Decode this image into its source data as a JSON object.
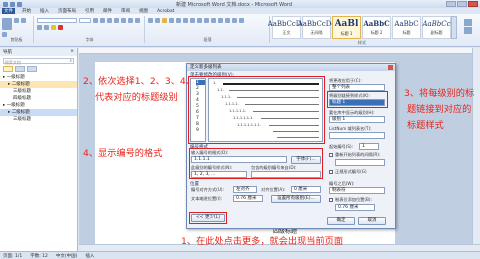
{
  "window": {
    "title": "新建 Microsoft Word 文档.docx - Microsoft Word"
  },
  "menu": [
    "文件",
    "开始",
    "插入",
    "页面布局",
    "引用",
    "邮件",
    "审阅",
    "视图",
    "Acrobat"
  ],
  "ribbon": {
    "styles": [
      {
        "sample": "AaBbCcDc",
        "name": "正文"
      },
      {
        "sample": "AaBbCcDc",
        "name": "无间隔"
      },
      {
        "sample": "AaBl",
        "name": "标题 1"
      },
      {
        "sample": "AaBbC",
        "name": "标题 2"
      },
      {
        "sample": "AaBbC",
        "name": "标题"
      },
      {
        "sample": "AaBbCc",
        "name": "副标题"
      }
    ],
    "groups": [
      "剪贴板",
      "字体",
      "段落",
      "样式"
    ]
  },
  "nav": {
    "title": "导航",
    "search_placeholder": "搜索文档",
    "tree": [
      {
        "label": "一级标题",
        "level": 1,
        "state": "normal"
      },
      {
        "label": "二级标题",
        "level": 2,
        "state": "highlight"
      },
      {
        "label": "三级标题",
        "level": 3,
        "state": "normal"
      },
      {
        "label": "四级标题",
        "level": 3,
        "state": "normal"
      },
      {
        "label": "一级标题",
        "level": 1,
        "state": "normal"
      },
      {
        "label": "二级标题",
        "level": 2,
        "state": "selected"
      },
      {
        "label": "三级标题",
        "level": 3,
        "state": "normal"
      }
    ]
  },
  "dialog": {
    "title": "定义新多级列表",
    "levels": [
      "1",
      "2",
      "3",
      "4",
      "5",
      "6",
      "7",
      "8",
      "9"
    ],
    "sec_level": "单击要修改的级别(V):",
    "apply_label": "将更改应用于(C):",
    "apply_value": "整个列表",
    "link_label": "将级别链接到样式(K):",
    "link_value": "标题 1",
    "gallery_label": "要在库中显示的级别(H):",
    "gallery_value": "级别 1",
    "listnum_label": "ListNum 域列表名(T):",
    "format_section": "编号格式",
    "format_label": "输入编号的格式(O):",
    "format_value": "1.1.1.1",
    "font_button": "字体(F)...",
    "style_label": "此级别的编号样式(N):",
    "style_value": "1, 2, 3, ...",
    "include_label": "包含的级别编号来自(D):",
    "start_label": "起始编号(S):",
    "start_value": "1",
    "restart_label": "重新开始列表的间隔(R):",
    "legal_label": "正规形式编号(G)",
    "position_section": "位置",
    "align_label": "编号对齐方式(U):",
    "align_value": "左对齐",
    "aligned_at_label": "对齐位置(A):",
    "aligned_at_value": "0 厘米",
    "indent_label": "文本缩进位置(I):",
    "indent_value": "0.76 厘米",
    "setall_button": "设置所有级别(E)...",
    "follow_label": "编号之后(W):",
    "follow_value": "制表符",
    "tab_label": "制表位添加位置(B):",
    "tab_value": "0.76 厘米",
    "less_button": "<< 更少(L)",
    "ok_button": "确定",
    "cancel_button": "取消",
    "preview_texts": [
      "1.",
      "1.1.",
      "1.1.1.",
      "1.1.1.1.",
      "1.1.1.1.1.",
      "1.1.1.1.1.1.",
      "1.1.1.1.1.1.1."
    ]
  },
  "doc": {
    "heading_text": "四级标题"
  },
  "annotations": {
    "a1": "1、在此处点击更多，就会出现当前页面",
    "a2_line1": "2、依次选择1、2、3、4、",
    "a2_line2": "代表对应的标题级别",
    "a3_line1": "3、将每级别的标",
    "a3_line2": "题链接到对应的",
    "a3_line3": "标题样式",
    "a4": "4、显示编号的格式"
  },
  "status": [
    "页面: 1/1",
    "字数: 12",
    "中文(中国)",
    "插入"
  ]
}
